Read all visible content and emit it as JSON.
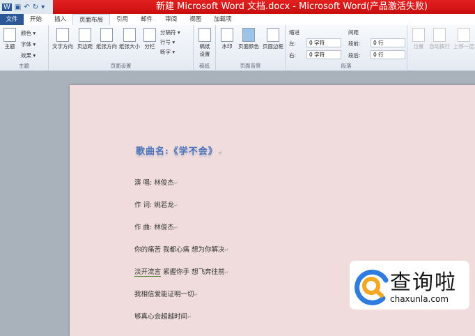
{
  "window": {
    "title": "新建 Microsoft Word 文档.docx - Microsoft Word(产品激活失败)"
  },
  "qat": {
    "word": "W",
    "save": "▣",
    "undo": "↶",
    "redo": "↻",
    "more": "▾"
  },
  "tabs": [
    "文件",
    "开始",
    "插入",
    "页面布局",
    "引用",
    "邮件",
    "审阅",
    "视图",
    "加载项"
  ],
  "ribbon": {
    "theme": {
      "label": "主题",
      "buttons": [
        "主题",
        "颜色 ▾",
        "字体 ▾",
        "效果 ▾"
      ]
    },
    "page_setup": {
      "label": "页面设置",
      "buttons": [
        "文字方向",
        "页边距",
        "纸张方向",
        "纸张大小",
        "分栏"
      ],
      "small": [
        "分隔符 ▾",
        "行号 ▾",
        "断字 ▾"
      ]
    },
    "draft": {
      "label": "稿纸",
      "buttons": [
        "稿纸\n设置"
      ]
    },
    "background": {
      "label": "页面背景",
      "buttons": [
        "水印",
        "页面颜色",
        "页面边框"
      ]
    },
    "paragraph": {
      "label": "段落",
      "indent_label": "缩进",
      "spacing_label": "间距",
      "left_label": "左:",
      "right_label": "右:",
      "left_value": "0 字符",
      "right_value": "0 字符",
      "before_label": "段前:",
      "after_label": "段后:",
      "before_value": "0 行",
      "after_value": "0 行"
    },
    "arrange": {
      "buttons": [
        "位置",
        "自动换行",
        "上移一层"
      ]
    }
  },
  "document": {
    "title": "歌曲名:《学不会》",
    "lines": [
      "演 唱:  林俊杰",
      "作 词:  姚若龙",
      "作 曲:  林俊杰",
      "你的痛苦 我都心痛 想为你解决",
      "紧握你手 想飞奔往前",
      "我相信爱能证明一切",
      "够真心会超越时间"
    ],
    "underlined": "淡开流言",
    "para_mark": "↵"
  },
  "watermark": {
    "cn": "查询啦",
    "en": "chaxunla.com"
  }
}
